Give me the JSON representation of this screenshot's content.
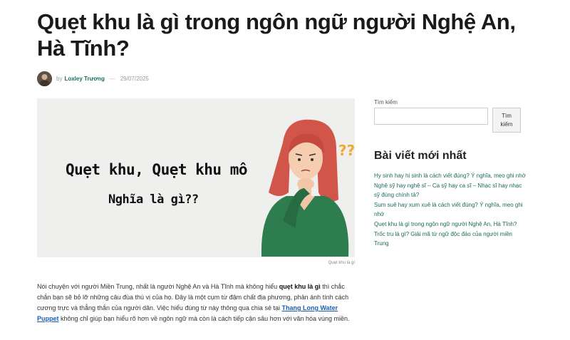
{
  "post": {
    "title": "Quẹt khu là gì trong ngôn ngữ người Nghệ An, Hà Tĩnh?",
    "by": "by",
    "author": "Loxley Trương",
    "separator": "—",
    "date": "29/07/2025"
  },
  "featured_image": {
    "text_line1": "Quẹt khu, Quẹt khu mô",
    "text_line2": "Nghĩa là gì??",
    "question_marks": "??",
    "caption": "Quẹt khu là gì"
  },
  "body": {
    "p1_a": "Nói chuyện với người Miền Trung, nhất là người Nghệ An và Hà Tĩnh mà không hiểu ",
    "p1_bold": "quẹt khu là gì",
    "p1_b": " thì chắc chắn bạn sẽ bỏ lỡ những câu đùa thú vị của họ. Đây là một cụm từ đậm chất địa phương, phản ánh tính cách cương trực và thẳng thắn của người dân. Việc hiểu đúng từ này thông qua chia sẻ tại ",
    "p1_link": "Thang Long Water Puppet",
    "p1_c": " không chỉ giúp bạn hiểu rõ hơn về ngôn ngữ mà còn là cách tiếp cận sâu hơn với văn hóa vùng miền."
  },
  "sidebar": {
    "search_label": "Tìm kiếm",
    "search_value": "",
    "search_button": "Tìm kiếm",
    "recent_title": "Bài viết mới nhất",
    "recent_posts": [
      "Hy sinh hay hi sinh là cách viết đúng? Ý nghĩa, mẹo ghi nhớ",
      "Nghệ sỹ hay nghệ sĩ – Ca sỹ hay ca sĩ – Nhạc sĩ hay nhạc sỹ đúng chính tả?",
      "Sum suê hay xum xuê là cách viết đúng? Ý nghĩa, mẹo ghi nhớ",
      "Quẹt khu là gì trong ngôn ngữ người Nghệ An, Hà Tĩnh?",
      "Trốc tru là gì? Giải mã từ ngữ độc đáo của người miền Trung"
    ]
  },
  "colors": {
    "link": "#1a6b5e",
    "inline_link": "#1a5fb4",
    "hair": "#d2554a",
    "sweater": "#2e7d4f",
    "question_mark": "#f0a830"
  }
}
